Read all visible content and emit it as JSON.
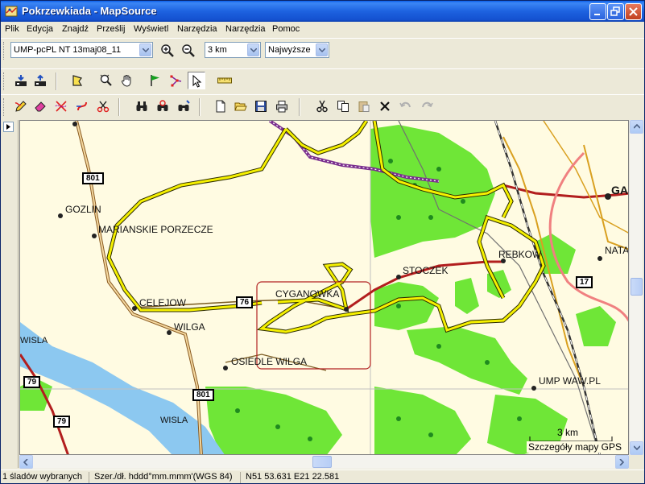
{
  "window": {
    "title": "Pokrzewkiada - MapSource"
  },
  "menu": [
    "Plik",
    "Edycja",
    "Znajdź",
    "Prześlij",
    "Wyświetl",
    "Narzędzia",
    "Narzędzia",
    "Pomoc"
  ],
  "toolbar1": {
    "map_product": "UMP-pcPL NT 13maj08_11",
    "zoom_scale": "3 km",
    "detail_level": "Najwyższe"
  },
  "map": {
    "places": {
      "gozlin": "GOZLIN",
      "marianskie": "MARIANSKIE PORZECZE",
      "celejow": "CELEJOW",
      "wilga": "WILGA",
      "osiedle_wilga": "OSIEDLE WILGA",
      "cyganowka": "CYGANOWKA",
      "stoczek": "STOCZEK",
      "rebkow": "REBKOW",
      "natalin": "NATA",
      "garwolin": "GA",
      "wisla_left": "WISLA",
      "wisla_river": "WISLA",
      "ump": "UMP WAW.PL"
    },
    "shields": {
      "r801_top": "801",
      "r801_bottom": "801",
      "r76": "76",
      "r17": "17",
      "r79_left": "79",
      "r79_bottom": "79"
    },
    "scale_label": "3 km",
    "detail_caption": "Szczegóły mapy GPS",
    "colors": {
      "background": "#fffbe2",
      "forest": "#6fe637",
      "water": "#8cc8f0",
      "track": "#f5f000",
      "main_road": "#b21e1e",
      "route_purple": "#7a2e8e",
      "selection": "#b22222"
    }
  },
  "status": {
    "selected": "1 śladów wybranych",
    "format": "Szer./dł. hddd°mm.mmm'(WGS 84)",
    "coords": "N51 53.631 E21 22.581"
  }
}
